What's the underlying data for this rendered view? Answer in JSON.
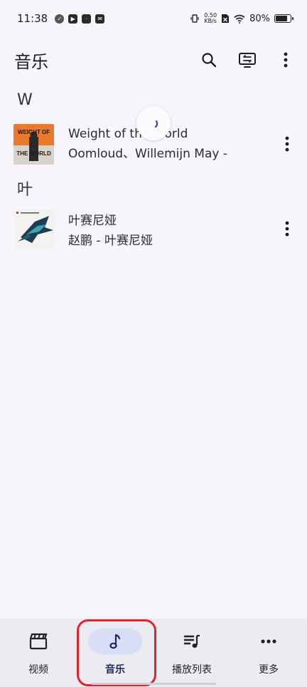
{
  "status_bar": {
    "time": "11:38",
    "net_speed_value": "0.50",
    "net_speed_unit": "KB/s",
    "battery": "80%",
    "battery_level": 0.8
  },
  "app_bar": {
    "title": "音乐"
  },
  "sections": [
    {
      "header": "W",
      "songs": [
        {
          "title": "Weight of the World",
          "subtitle": "Oomloud、Willemijn May -",
          "art_text": "WEIGHT OF THE WORLD"
        }
      ]
    },
    {
      "header": "叶",
      "songs": [
        {
          "title": "叶赛尼娅",
          "subtitle": "赵鹏 - 叶赛尼娅",
          "art_text": "叶赛尼娅"
        }
      ]
    }
  ],
  "bottom_nav": {
    "items": [
      {
        "label": "视频",
        "icon": "clapperboard-icon",
        "active": false
      },
      {
        "label": "音乐",
        "icon": "music-note-icon",
        "active": true
      },
      {
        "label": "播放列表",
        "icon": "playlist-icon",
        "active": false
      },
      {
        "label": "更多",
        "icon": "more-horizontal-icon",
        "active": false
      }
    ]
  },
  "colors": {
    "background": "#f7f5fb",
    "nav_background": "#ecebf1",
    "active_pill": "#d9def7",
    "highlight": "#e0242c"
  }
}
